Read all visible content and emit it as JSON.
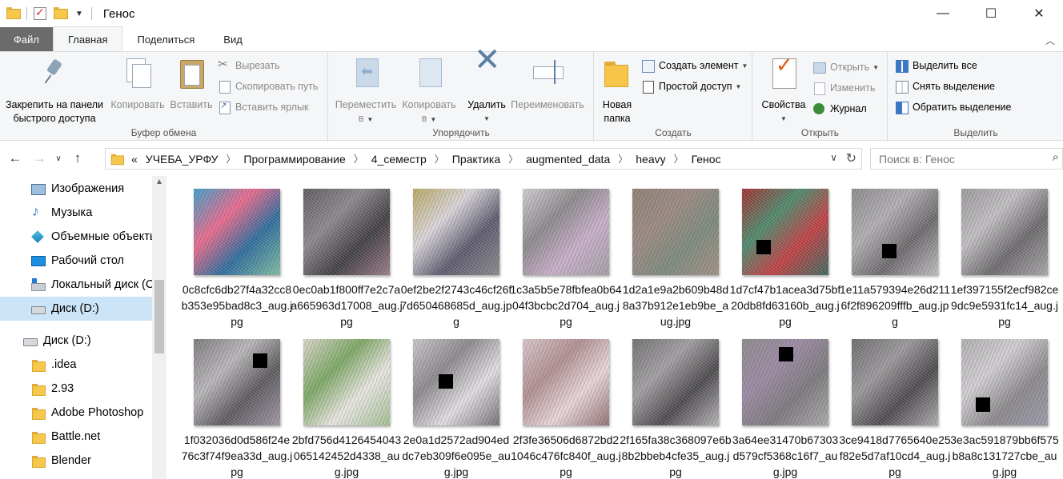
{
  "window": {
    "title": "Генос",
    "minimize": "—",
    "maximize": "☐",
    "close": "✕"
  },
  "ribbon_tabs": [
    "Файл",
    "Главная",
    "Поделиться",
    "Вид"
  ],
  "ribbon": {
    "clipboard": {
      "pin_line1": "Закрепить на панели",
      "pin_line2": "быстрого доступа",
      "copy": "Копировать",
      "paste": "Вставить",
      "cut": "Вырезать",
      "copy_path": "Скопировать путь",
      "paste_shortcut": "Вставить ярлык",
      "label": "Буфер обмена"
    },
    "organize": {
      "move_line1": "Переместить",
      "move_line2": "в",
      "copyto_line1": "Копировать",
      "copyto_line2": "в",
      "delete": "Удалить",
      "rename": "Переименовать",
      "label": "Упорядочить"
    },
    "new": {
      "newfolder_line1": "Новая",
      "newfolder_line2": "папка",
      "new_item": "Создать элемент",
      "easy_access": "Простой доступ",
      "label": "Создать"
    },
    "open": {
      "properties": "Свойства",
      "open": "Открыть",
      "edit": "Изменить",
      "history": "Журнал",
      "label": "Открыть"
    },
    "select": {
      "select_all": "Выделить все",
      "select_none": "Снять выделение",
      "invert": "Обратить выделение",
      "label": "Выделить"
    }
  },
  "address": {
    "prefix": "«",
    "crumbs": [
      "УЧЕБА_УРФУ",
      "Программирование",
      "4_семестр",
      "Практика",
      "augmented_data",
      "heavy",
      "Генос"
    ],
    "search_placeholder": "Поиск в: Генос"
  },
  "nav_pane": [
    {
      "label": "Изображения",
      "icon": "pictures-icon"
    },
    {
      "label": "Музыка",
      "icon": "music-icon"
    },
    {
      "label": "Объемные объекты",
      "icon": "3d-objects-icon"
    },
    {
      "label": "Рабочий стол",
      "icon": "desktop-icon"
    },
    {
      "label": "Локальный диск (C:)",
      "icon": "windows-drive-icon"
    },
    {
      "label": "Диск (D:)",
      "icon": "drive-icon"
    },
    {
      "label": "Диск (D:)",
      "icon": "drive-icon"
    },
    {
      "label": ".idea",
      "icon": "folder-icon"
    },
    {
      "label": "2.93",
      "icon": "folder-icon"
    },
    {
      "label": "Adobe Photoshop",
      "icon": "folder-icon"
    },
    {
      "label": "Battle.net",
      "icon": "folder-icon"
    },
    {
      "label": "Blender",
      "icon": "folder-icon"
    }
  ],
  "files": [
    {
      "name": "0c8cfc6db27f4a32cc8b353e95bad8c3_aug.jpg",
      "colors": [
        "#3aa0c8",
        "#e86a8a",
        "#2a6e9a",
        "#7fc0a0"
      ]
    },
    {
      "name": "0ec0ab1f800ff7e2c7aa665963d17008_aug.jpg",
      "colors": [
        "#5a5a5a",
        "#8a8a8a",
        "#3e3e3e",
        "#9a7e8a"
      ]
    },
    {
      "name": "0ef2be2f2743c46cf26f7d650468685d_aug.jpg",
      "colors": [
        "#b8a860",
        "#d8d8d8",
        "#5a5a6a",
        "#8a8a8a"
      ]
    },
    {
      "name": "1c3a5b5e78fbfea0b6404f3bcbc2d704_aug.jpg",
      "colors": [
        "#d0d0d0",
        "#8a8a8a",
        "#c8b0c8",
        "#a0a0a0"
      ]
    },
    {
      "name": "1d2a1e9a2b609b48d8a37b912e1eb9be_aug.jpg",
      "colors": [
        "#8a8070",
        "#9a8a80",
        "#7a8a7a",
        "#a09080"
      ]
    },
    {
      "name": "1d7cf47b1acea3d75bf20db8fd63160b_aug.jpg",
      "colors": [
        "#a0302a",
        "#4a8a6a",
        "#c04040",
        "#3a6a5a"
      ]
    },
    {
      "name": "1e11a579394e26d2116f2f896209fffb_aug.jpg",
      "colors": [
        "#8a8a8a",
        "#b0b0b0",
        "#6a6a6a",
        "#c0c0c0"
      ]
    },
    {
      "name": "1ef397155f2ecf982ce9dc9e5931fc14_aug.jpg",
      "colors": [
        "#9a9a9a",
        "#c0c0c0",
        "#6a6a6a",
        "#a8a8a8"
      ]
    },
    {
      "name": "1f032036d0d586f24e76c3f74f9ea33d_aug.jpg",
      "colors": [
        "#7a7a7a",
        "#b8b8b8",
        "#5a5a5a",
        "#a09aa8"
      ]
    },
    {
      "name": "2bfd756d4126454043065142452d4338_aug.jpg",
      "colors": [
        "#d8d8c8",
        "#7aa860",
        "#e8e8e0",
        "#a0c090"
      ]
    },
    {
      "name": "2e0a1d2572ad904eddc7eb309f6e095e_aug.jpg",
      "colors": [
        "#c8c8c8",
        "#8a8a8a",
        "#e0e0e0",
        "#707070"
      ]
    },
    {
      "name": "2f3fe36506d6872bd21046c476fc840f_aug.jpg",
      "colors": [
        "#d8c8c8",
        "#b09090",
        "#e8d8d8",
        "#907070"
      ]
    },
    {
      "name": "2f165fa38c368097e6b8b2bbeb4cfe35_aug.jpg",
      "colors": [
        "#707070",
        "#a0a0a0",
        "#4a4a4a",
        "#b8b8b8"
      ]
    },
    {
      "name": "3a64ee31470b67303d579cf5368c16f7_aug.jpg",
      "colors": [
        "#8a8a8a",
        "#9a8aa0",
        "#7a7a7a",
        "#aaaaaa"
      ]
    },
    {
      "name": "3ce9418d7765640e25f82e5d7af10cd4_aug.jpg",
      "colors": [
        "#6a6a6a",
        "#9a9a9a",
        "#4a4a4a",
        "#b0b0b0"
      ]
    },
    {
      "name": "3e3ac591879bb6f575b8a8c131727cbe_aug.jpg",
      "colors": [
        "#b0b0b0",
        "#d0d0d0",
        "#8a8a8a",
        "#9a9aa8"
      ]
    }
  ]
}
